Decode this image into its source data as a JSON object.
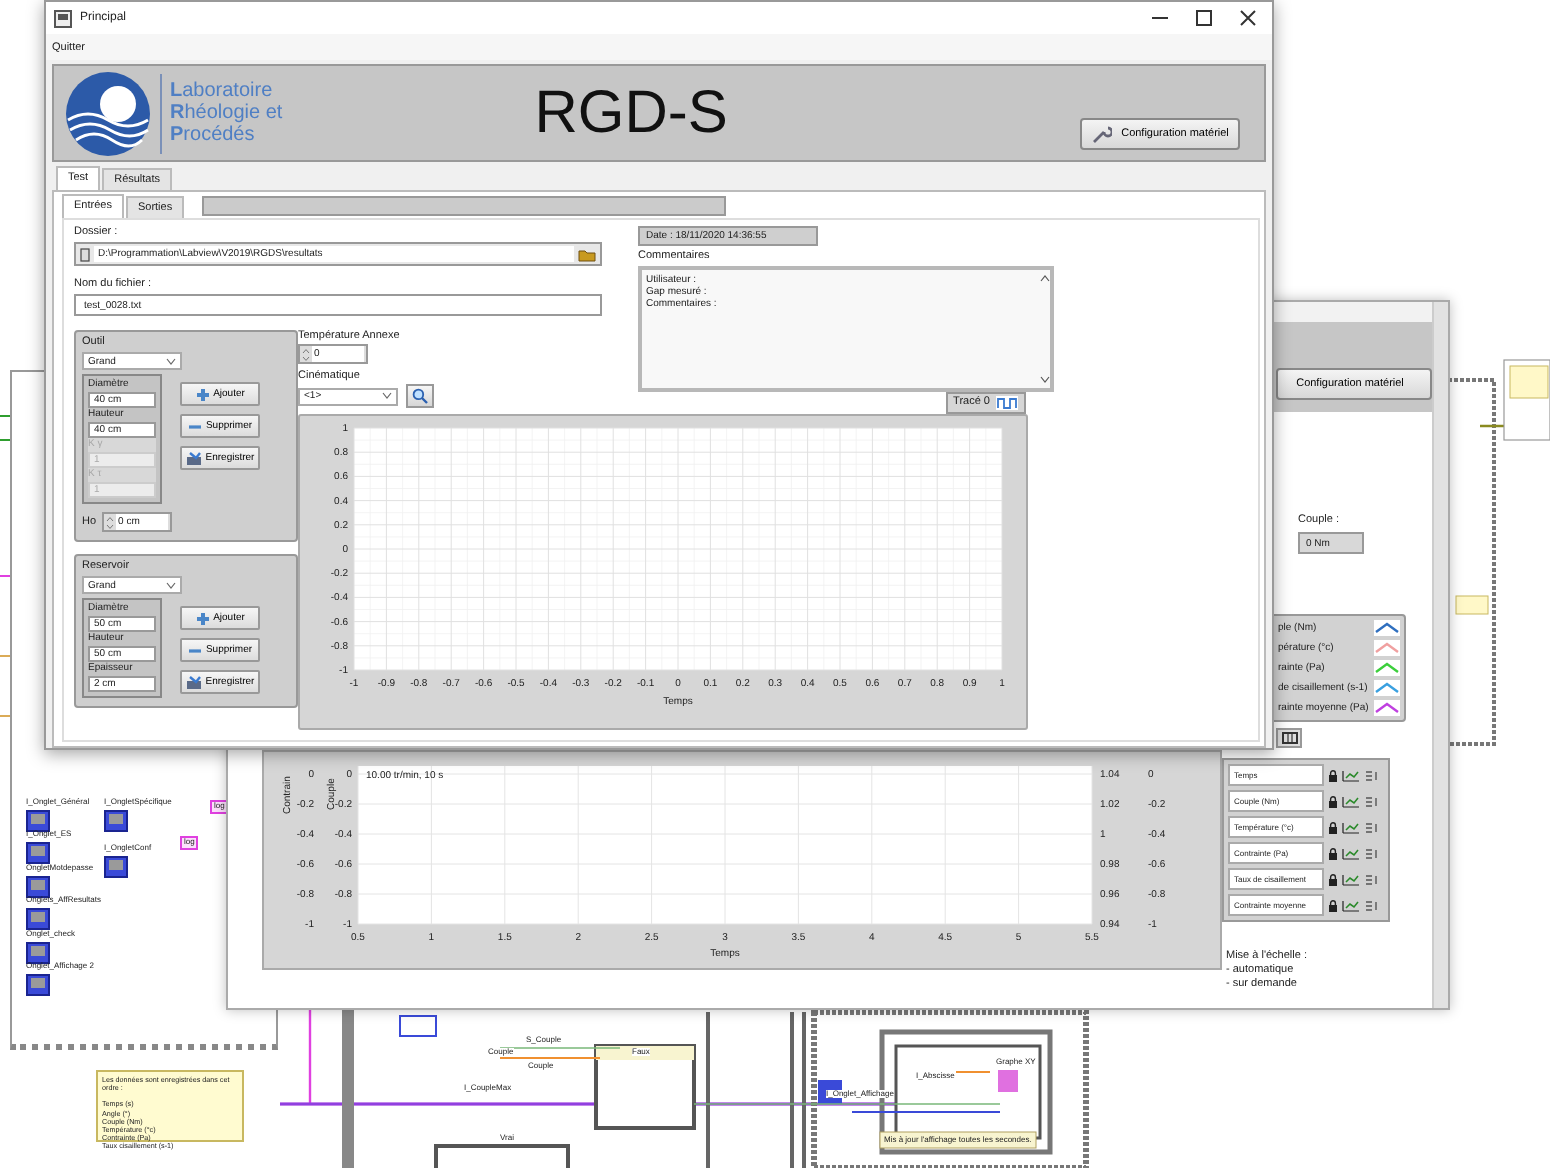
{
  "background_diagram": {
    "terminals": [
      "I_Onglet_Général",
      "I_OngletSpécifique",
      "I_Onglet_ES",
      "I_OngletConf",
      "OngletMotdepasse",
      "Onglets_AffResultats",
      "Onglet_check",
      "Onglet_Affichage 2"
    ],
    "tags": [
      "log",
      "log"
    ],
    "note": {
      "title": "Les données sont enregistrées dans cet ordre :",
      "lines": [
        "Temps (s)",
        "Angle (°)",
        "Couple (Nm)",
        "Température (°c)",
        "Contrainte (Pa)",
        "Taux cisaillement (s-1)"
      ]
    },
    "labels": [
      "S_Couple",
      "Couple",
      "Faux",
      "Graphe XY",
      "Couple",
      "I_Abscisse",
      "I_CoupleMax",
      "I_Onglet_Affichage",
      "Vrai"
    ],
    "comment": "Mis à jour l'affichage toutes les secondes."
  },
  "back_window": {
    "config_button": "Configuration matériel",
    "couple": {
      "label": "Couple :",
      "value": "0 Nm"
    },
    "legend": [
      {
        "label": "ple (Nm)",
        "color": "#2f6fbf"
      },
      {
        "label": "pérature (°c)",
        "color": "#f0a0a0"
      },
      {
        "label": "rainte (Pa)",
        "color": "#3ccf3c"
      },
      {
        "label": "de cisaillement (s-1)",
        "color": "#3aa0e0"
      },
      {
        "label": "rainte moyenne (Pa)",
        "color": "#c040e0"
      }
    ],
    "scales": [
      "Temps",
      "Couple (Nm)",
      "Température (°c)",
      "Contrainte (Pa)",
      "Taux de cisaillement",
      "Contrainte moyenne"
    ],
    "scale_note": [
      "Mise à l'échelle :",
      "- automatique",
      "- sur demande"
    ],
    "extra_axes": [
      {
        "kind": "left_axis",
        "label": "Contrain",
        "ticks": [
          "0",
          "-0.2",
          "-0.4",
          "-0.6",
          "-0.8",
          "-1"
        ]
      },
      {
        "kind": "right_axis",
        "ticks": [
          "1.04",
          "1.02",
          "1",
          "0.98",
          "0.96",
          "0.94"
        ]
      },
      {
        "kind": "right_axis",
        "ticks": [
          "0",
          "-0.2",
          "-0.4",
          "-0.6",
          "-0.8",
          "-1"
        ]
      }
    ],
    "chart_data": {
      "type": "line",
      "xlabel": "Temps",
      "ylabel": "Couple",
      "xlim": [
        0.5,
        5.5
      ],
      "ylim": [
        -1,
        0
      ],
      "xticks": [
        0.5,
        1,
        1.5,
        2,
        2.5,
        3,
        3.5,
        4,
        4.5,
        5,
        5.5
      ],
      "yticks": [
        0,
        -0.2,
        -0.4,
        -0.6,
        -0.8,
        -1
      ],
      "grid": true,
      "annotations": [
        "10.00  tr/min, 10 s"
      ]
    }
  },
  "main_window": {
    "title": "Principal",
    "menu": [
      "Quitter"
    ],
    "logo_lines": [
      "**L**aboratoire",
      "**R**héologie et",
      "**P**rocédés"
    ],
    "app_title": "RGD-S",
    "config_button": "Configuration matériel",
    "tabs": [
      {
        "label": "Test",
        "selected": true
      },
      {
        "label": "Résultats",
        "selected": false
      }
    ],
    "subtabs": [
      {
        "label": "Entrées",
        "selected": true
      },
      {
        "label": "Sorties",
        "selected": false
      }
    ],
    "folder": {
      "label": "Dossier :",
      "value": "D:\\Programmation\\Labview\\V2019\\RGDS\\resultats"
    },
    "file": {
      "label": "Nom du fichier :",
      "value": "test_0028.txt"
    },
    "date": "Date : 18/11/2020 14:36:55",
    "comments": {
      "label": "Commentaires",
      "lines": [
        "Utilisateur :",
        "Gap mesuré :",
        "Commentaires :"
      ]
    },
    "groups": [
      {
        "title": "Outil",
        "selection": "Grand",
        "fields": [
          {
            "label": "Diamètre",
            "value": "40 cm",
            "disabled": false
          },
          {
            "label": "Hauteur",
            "value": "40 cm",
            "disabled": false
          },
          {
            "label": "K γ",
            "value": "1",
            "disabled": true
          },
          {
            "label": "K τ",
            "value": "1",
            "disabled": true
          }
        ],
        "extra": {
          "label": "Ho",
          "value": "0 cm"
        },
        "buttons": [
          {
            "label": "Ajouter",
            "kind": "add"
          },
          {
            "label": "Supprimer",
            "kind": "remove"
          },
          {
            "label": "Enregistrer",
            "kind": "save"
          }
        ]
      },
      {
        "title": "Reservoir",
        "selection": "Grand",
        "fields": [
          {
            "label": "Diamètre",
            "value": "50 cm",
            "disabled": false
          },
          {
            "label": "Hauteur",
            "value": "50 cm",
            "disabled": false
          },
          {
            "label": "Epaisseur",
            "value": "2 cm",
            "disabled": false
          }
        ],
        "buttons": [
          {
            "label": "Ajouter",
            "kind": "add"
          },
          {
            "label": "Supprimer",
            "kind": "remove"
          },
          {
            "label": "Enregistrer",
            "kind": "save"
          }
        ]
      }
    ],
    "temperature": {
      "label": "Température Annexe",
      "value": "0"
    },
    "kinematics": {
      "label": "Cinématique",
      "value": "<1>"
    },
    "legend": "Tracé 0",
    "chart_data": {
      "type": "line",
      "xlabel": "Temps",
      "xlim": [
        -1,
        1
      ],
      "ylim": [
        -1,
        1
      ],
      "xticks": [
        -1,
        -0.9,
        -0.8,
        -0.7,
        -0.6,
        -0.5,
        -0.4,
        -0.3,
        -0.2,
        -0.1,
        0,
        0.1,
        0.2,
        0.3,
        0.4,
        0.5,
        0.6,
        0.7,
        0.8,
        0.9,
        1
      ],
      "yticks": [
        1,
        0.8,
        0.6,
        0.4,
        0.2,
        0,
        -0.2,
        -0.4,
        -0.6,
        -0.8,
        -1
      ],
      "grid": true
    }
  }
}
